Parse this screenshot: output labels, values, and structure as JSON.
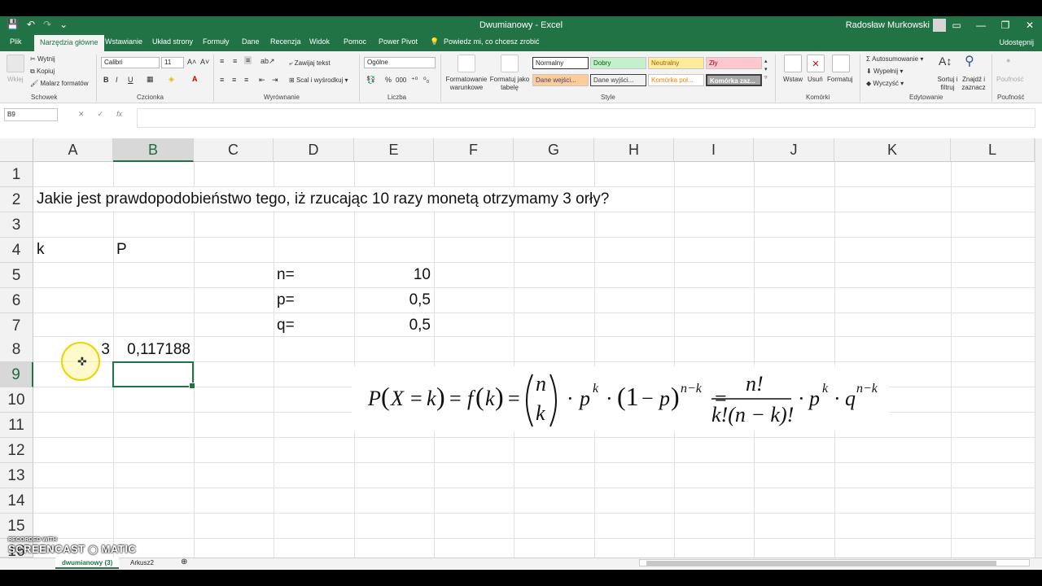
{
  "window": {
    "title": "Dwumianowy - Excel",
    "user": "Radosław Murkowski",
    "controls": [
      "▭",
      "—",
      "❐",
      "✕"
    ]
  },
  "qat": {
    "save": "💾",
    "undo": "↶",
    "redo": "↷",
    "more": "⌄"
  },
  "tabs": [
    {
      "label": "Plik"
    },
    {
      "label": "Narzędzia główne"
    },
    {
      "label": "Wstawianie"
    },
    {
      "label": "Układ strony"
    },
    {
      "label": "Formuły"
    },
    {
      "label": "Dane"
    },
    {
      "label": "Recenzja"
    },
    {
      "label": "Widok"
    },
    {
      "label": "Pomoc"
    },
    {
      "label": "Power Pivot"
    },
    {
      "label": "Powiedz mi, co chcesz zrobić"
    }
  ],
  "share_label": "Udostępnij",
  "ribbon": {
    "clipboard": {
      "paste": "Wklej",
      "cut": "Wytnij",
      "copy": "Kopiuj",
      "painter": "Malarz formatów",
      "label": "Schowek"
    },
    "font": {
      "name": "Calibri",
      "size": "11",
      "label": "Czcionka",
      "bold": "B",
      "italic": "I",
      "underline": "U"
    },
    "alignment": {
      "wrap": "Zawijaj tekst",
      "merge": "Scal i wyśrodkuj",
      "label": "Wyrównanie"
    },
    "number": {
      "format": "Ogólne",
      "label": "Liczba",
      "pct": "%",
      "thousands": "000"
    },
    "styles": {
      "cond": "Formatowanie warunkowe",
      "table": "Formatuj jako tabelę",
      "label": "Style",
      "cells": [
        "Normalny",
        "Dobry",
        "Neutralny",
        "Zły",
        "Dane wejści...",
        "Dane wyjści...",
        "Komórka poł...",
        "Komórka zaz..."
      ]
    },
    "cells": {
      "insert": "Wstaw",
      "delete": "Usuń",
      "format": "Formatuj",
      "label": "Komórki"
    },
    "editing": {
      "autosum": "Autosumowanie",
      "fill": "Wypełnij",
      "clear": "Wyczyść",
      "sort": "Sortuj i filtruj",
      "find": "Znajdź i zaznacz",
      "label": "Edytowanie"
    },
    "privacy": {
      "btn": "Poufność",
      "label": "Poufność"
    }
  },
  "formula_bar": {
    "name_box": "B9",
    "cancel": "✕",
    "enter": "✓",
    "fx": "fx",
    "value": ""
  },
  "columns": [
    "A",
    "B",
    "C",
    "D",
    "E",
    "F",
    "G",
    "H",
    "I",
    "J",
    "K",
    "L"
  ],
  "rows": [
    "1",
    "2",
    "3",
    "4",
    "5",
    "6",
    "7",
    "8",
    "9",
    "10",
    "11",
    "12",
    "13",
    "14",
    "15",
    "16"
  ],
  "cells": {
    "A2": "Jakie jest prawdopodobieństwo tego, iż rzucając 10 razy monetą otrzymamy 3 orły?",
    "A4": "k",
    "B4": "P",
    "D5": "n=",
    "E5": "10",
    "D6": "p=",
    "E6": "0,5",
    "D7": "q=",
    "E7": "0,5",
    "A8": "3",
    "B8": "0,117188"
  },
  "sheets": [
    "dwumianowy (3)",
    "Arkusz2"
  ],
  "add_sheet": "⊕",
  "watermark": {
    "line1": "RECORDED WITH",
    "line2": "SCREENCAST ◉ MATIC"
  },
  "colors": {
    "accent": "#217346"
  }
}
